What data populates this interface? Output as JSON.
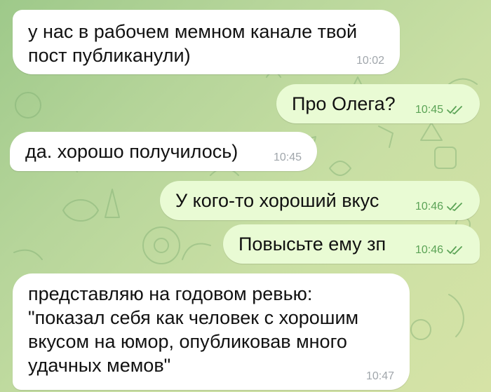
{
  "messages": [
    {
      "direction": "incoming",
      "text": "у нас в рабочем мемном канале твой\nпост публиканули)",
      "time": "10:02"
    },
    {
      "direction": "outgoing",
      "text": "Про Олега?",
      "time": "10:45",
      "status_icon": "double-check-icon"
    },
    {
      "direction": "incoming",
      "text": "да. хорошо получилось)",
      "time": "10:45"
    },
    {
      "direction": "outgoing",
      "text": "У кого-то хороший вкус",
      "time": "10:46",
      "status_icon": "double-check-icon"
    },
    {
      "direction": "outgoing",
      "text": "Повысьте ему зп",
      "time": "10:46",
      "status_icon": "double-check-icon"
    },
    {
      "direction": "incoming",
      "text": "представляю на годовом ревью:\n\"показал себя как человек с хорошим\nвкусом на юмор, опубликовав много\nудачных мемов\"",
      "time": "10:47"
    }
  ],
  "colors": {
    "incoming_bubble": "#ffffff",
    "outgoing_bubble": "#e9fbd4",
    "incoming_time": "#a0a6ab",
    "outgoing_time": "#5ba356",
    "wallpaper_start": "#9ec98a",
    "wallpaper_end": "#d6e3a6"
  }
}
